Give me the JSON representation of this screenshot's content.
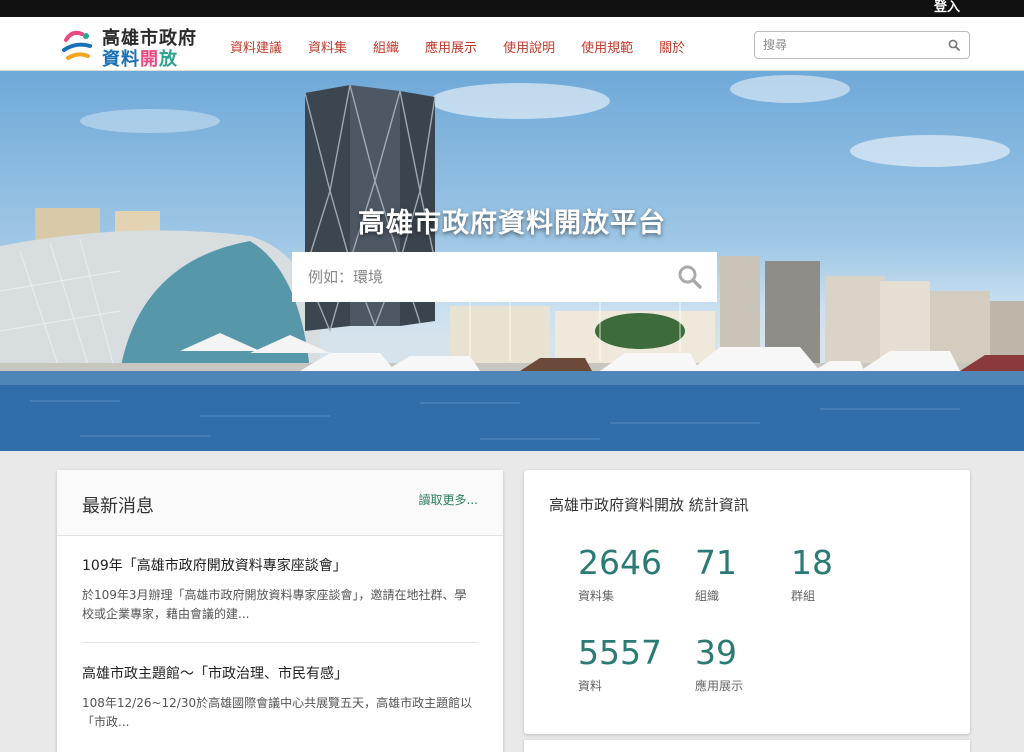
{
  "topbar": {
    "login_label": "登入"
  },
  "logo": {
    "line1": "高雄市政府",
    "line2_chars": [
      "資",
      "料",
      "開",
      "放"
    ]
  },
  "nav": {
    "items": [
      {
        "label": "資料建議"
      },
      {
        "label": "資料集"
      },
      {
        "label": "組織"
      },
      {
        "label": "應用展示"
      },
      {
        "label": "使用說明"
      },
      {
        "label": "使用規範"
      },
      {
        "label": "關於"
      }
    ],
    "search_placeholder": "搜尋"
  },
  "hero": {
    "title": "高雄市政府資料開放平台",
    "search_placeholder": "例如：環境"
  },
  "news": {
    "title": "最新消息",
    "more_label": "讀取更多...",
    "items": [
      {
        "title": "109年「高雄市政府開放資料專家座談會」",
        "desc": "於109年3月辦理「高雄市政府開放資料專家座談會」，邀請在地社群、學校或企業專家，藉由會議的建..."
      },
      {
        "title": "高雄市政主題館～「市政治理、市民有感」",
        "desc": "108年12/26~12/30於高雄國際會議中心共展覽五天，高雄市政主題館以「市政..."
      }
    ]
  },
  "stats": {
    "title": "高雄市政府資料開放 統計資訊",
    "items": [
      {
        "value": "2646",
        "label": "資料集"
      },
      {
        "value": "71",
        "label": "組織"
      },
      {
        "value": "18",
        "label": "群組"
      },
      {
        "value": "5557",
        "label": "資料"
      },
      {
        "value": "39",
        "label": "應用展示"
      }
    ]
  },
  "colors": {
    "nav_link": "#c0392b",
    "stat_number": "#2b7a73",
    "more_link": "#2e7d5b"
  }
}
